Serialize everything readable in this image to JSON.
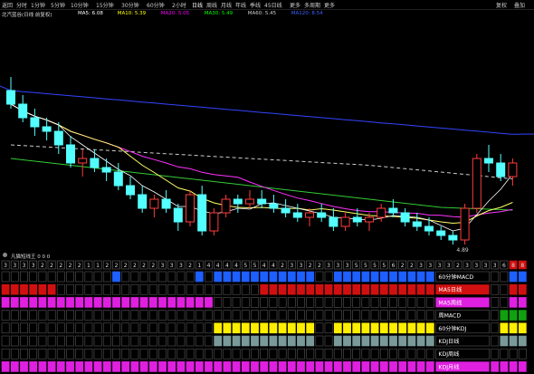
{
  "period_bar": {
    "items": [
      {
        "label": "返回"
      },
      {
        "label": "分时"
      },
      {
        "label": "1分钟"
      },
      {
        "label": "5分钟"
      },
      {
        "label": "10分钟"
      },
      {
        "label": "15分钟"
      },
      {
        "label": "30分钟"
      },
      {
        "label": "60分钟"
      },
      {
        "label": "2小时"
      },
      {
        "label": "日线",
        "active": true
      },
      {
        "label": "周线"
      },
      {
        "label": "月线"
      },
      {
        "label": "年线"
      },
      {
        "label": "季线"
      },
      {
        "label": "45日线"
      },
      {
        "label": "更多"
      },
      {
        "label": "多周期"
      },
      {
        "label": "更多"
      }
    ],
    "right_items": [
      {
        "label": "复权"
      },
      {
        "label": "叠加"
      }
    ]
  },
  "indicators": {
    "stock_name": "北汽蓝谷(日线 前复权)",
    "items": [
      {
        "label": "MA5: 6.08",
        "color": "#ffffff"
      },
      {
        "label": "MA10: 5.39",
        "color": "#ffff00"
      },
      {
        "label": "MA20: 5.05",
        "color": "#ff00ff"
      },
      {
        "label": "MA30: 5.49",
        "color": "#00ff00"
      },
      {
        "label": "MA60: 5.45",
        "color": "#cccccc"
      },
      {
        "label": "MA120: 8.54",
        "color": "#4060ff"
      }
    ]
  },
  "colors": {
    "up": "#ff3b3b",
    "down": "#54ffff",
    "ma5": "#ffffff",
    "ma10": "#ffff66",
    "ma20": "#ff33ff",
    "ma30": "#33cc33",
    "ma120": "#3344ff",
    "blue_cell": "#1e5fff",
    "red_cell": "#d01010",
    "magenta_cell": "#e020e0",
    "yellow_cell": "#ffee00",
    "gray_cell": "#7a9a9a",
    "green_cell": "#10a010"
  },
  "chart_data": {
    "type": "candlestick",
    "ylim": [
      4.0,
      11.0
    ],
    "annotation_low": "4.89",
    "bars": [
      {
        "o": 7.6,
        "h": 7.9,
        "l": 7.2,
        "c": 7.3
      },
      {
        "o": 7.3,
        "h": 7.5,
        "l": 6.9,
        "c": 7.0
      },
      {
        "o": 7.0,
        "h": 7.2,
        "l": 6.6,
        "c": 6.8
      },
      {
        "o": 6.8,
        "h": 7.0,
        "l": 6.5,
        "c": 6.7
      },
      {
        "o": 6.7,
        "h": 6.9,
        "l": 6.2,
        "c": 6.4
      },
      {
        "o": 6.4,
        "h": 6.6,
        "l": 5.9,
        "c": 6.0
      },
      {
        "o": 6.0,
        "h": 6.3,
        "l": 5.7,
        "c": 6.1
      },
      {
        "o": 6.1,
        "h": 6.3,
        "l": 5.8,
        "c": 5.9
      },
      {
        "o": 5.9,
        "h": 6.1,
        "l": 5.6,
        "c": 5.8
      },
      {
        "o": 5.8,
        "h": 6.0,
        "l": 5.4,
        "c": 5.5
      },
      {
        "o": 5.5,
        "h": 5.7,
        "l": 5.2,
        "c": 5.3
      },
      {
        "o": 5.3,
        "h": 5.5,
        "l": 4.9,
        "c": 5.0
      },
      {
        "o": 5.0,
        "h": 5.3,
        "l": 4.8,
        "c": 5.2
      },
      {
        "o": 5.2,
        "h": 5.4,
        "l": 4.9,
        "c": 5.0
      },
      {
        "o": 5.0,
        "h": 5.1,
        "l": 4.5,
        "c": 4.7
      },
      {
        "o": 4.7,
        "h": 5.4,
        "l": 4.6,
        "c": 5.3
      },
      {
        "o": 5.3,
        "h": 5.5,
        "l": 4.4,
        "c": 4.5
      },
      {
        "o": 4.5,
        "h": 5.0,
        "l": 4.4,
        "c": 4.9
      },
      {
        "o": 4.9,
        "h": 5.3,
        "l": 4.8,
        "c": 5.2
      },
      {
        "o": 5.2,
        "h": 5.3,
        "l": 4.9,
        "c": 5.1
      },
      {
        "o": 5.1,
        "h": 5.4,
        "l": 5.0,
        "c": 5.2
      },
      {
        "o": 5.2,
        "h": 5.4,
        "l": 5.0,
        "c": 5.1
      },
      {
        "o": 5.1,
        "h": 5.3,
        "l": 4.9,
        "c": 5.0
      },
      {
        "o": 5.0,
        "h": 5.2,
        "l": 4.8,
        "c": 4.9
      },
      {
        "o": 4.9,
        "h": 5.1,
        "l": 4.7,
        "c": 4.8
      },
      {
        "o": 4.8,
        "h": 5.0,
        "l": 4.6,
        "c": 4.9
      },
      {
        "o": 4.9,
        "h": 5.1,
        "l": 4.7,
        "c": 4.8
      },
      {
        "o": 4.8,
        "h": 5.0,
        "l": 4.5,
        "c": 4.6
      },
      {
        "o": 4.6,
        "h": 4.9,
        "l": 4.5,
        "c": 4.8
      },
      {
        "o": 4.8,
        "h": 5.0,
        "l": 4.6,
        "c": 4.7
      },
      {
        "o": 4.7,
        "h": 4.9,
        "l": 4.5,
        "c": 4.8
      },
      {
        "o": 4.8,
        "h": 5.1,
        "l": 4.7,
        "c": 5.0
      },
      {
        "o": 5.0,
        "h": 5.2,
        "l": 4.8,
        "c": 4.9
      },
      {
        "o": 4.9,
        "h": 5.0,
        "l": 4.6,
        "c": 4.7
      },
      {
        "o": 4.7,
        "h": 4.9,
        "l": 4.5,
        "c": 4.6
      },
      {
        "o": 4.6,
        "h": 4.8,
        "l": 4.4,
        "c": 4.5
      },
      {
        "o": 4.5,
        "h": 4.6,
        "l": 4.3,
        "c": 4.4
      },
      {
        "o": 4.4,
        "h": 4.5,
        "l": 4.2,
        "c": 4.3
      },
      {
        "o": 4.3,
        "h": 5.1,
        "l": 4.2,
        "c": 5.0
      },
      {
        "o": 5.0,
        "h": 6.2,
        "l": 4.9,
        "c": 6.1
      },
      {
        "o": 6.1,
        "h": 6.4,
        "l": 5.8,
        "c": 6.0
      },
      {
        "o": 6.0,
        "h": 6.2,
        "l": 5.6,
        "c": 5.7
      },
      {
        "o": 5.7,
        "h": 6.1,
        "l": 5.5,
        "c": 6.0
      }
    ]
  },
  "sub_panel": {
    "title": "凡猫短线王 0 0 0"
  },
  "signal_grid": {
    "count_row": [
      "3",
      "3",
      "3",
      "3",
      "2",
      "2",
      "2",
      "2",
      "2",
      "1",
      "1",
      "2",
      "2",
      "2",
      "2",
      "2",
      "2",
      "3",
      "3",
      "3",
      "2",
      "1",
      "4",
      "4",
      "4",
      "4",
      "5",
      "5",
      "4",
      "4",
      "2",
      "3",
      "3",
      "2",
      "2",
      "3",
      "3",
      "3",
      "5",
      "5",
      "5",
      "5",
      "6",
      "2",
      "2",
      "3",
      "3",
      "3",
      "3",
      "2",
      "3",
      "3",
      "3",
      "3",
      "6",
      "8",
      "8"
    ],
    "count_highlight": [
      55,
      56
    ],
    "rows": [
      {
        "label": "60分钟MACD",
        "label_color": "#ffffff",
        "label_bg": "",
        "cell": "blue_cell",
        "on": [
          12,
          21,
          23,
          24,
          25,
          26,
          27,
          28,
          29,
          30,
          31,
          32,
          33,
          36,
          37,
          38,
          39,
          40,
          41,
          42,
          43,
          44,
          45,
          46,
          49,
          55,
          56
        ]
      },
      {
        "label": "MA5日线",
        "label_color": "#ffffff",
        "label_bg": "#d01010",
        "cell": "red_cell",
        "on": [
          0,
          1,
          2,
          3,
          4,
          5,
          28,
          29,
          30,
          31,
          32,
          33,
          34,
          35,
          36,
          37,
          38,
          39,
          40,
          41,
          42,
          43,
          44,
          45,
          46,
          47,
          48,
          49,
          50,
          55,
          56
        ]
      },
      {
        "label": "MA5周线",
        "label_color": "#ffffff",
        "label_bg": "#e020e0",
        "cell": "magenta_cell",
        "on": [
          0,
          1,
          2,
          3,
          4,
          5,
          6,
          7,
          8,
          9,
          10,
          11,
          12,
          13,
          14,
          15,
          16,
          17,
          18,
          19,
          20,
          21,
          22,
          55,
          56
        ]
      },
      {
        "label": "周MACD",
        "label_color": "#ffffff",
        "label_bg": "",
        "cell": "green_cell",
        "on": [
          54,
          55,
          56
        ]
      },
      {
        "label": "60分钟KDJ",
        "label_color": "#ffffff",
        "label_bg": "",
        "cell": "yellow_cell",
        "on": [
          23,
          24,
          25,
          26,
          27,
          28,
          29,
          30,
          31,
          32,
          33,
          36,
          37,
          38,
          39,
          40,
          41,
          42,
          43,
          44,
          45,
          46,
          54,
          55,
          56
        ]
      },
      {
        "label": "KDJ日线",
        "label_color": "#ffffff",
        "label_bg": "",
        "cell": "gray_cell",
        "on": [
          23,
          24,
          25,
          26,
          27,
          28,
          29,
          30,
          31,
          32,
          33,
          36,
          37,
          38,
          39,
          40,
          41,
          42,
          43,
          44,
          45,
          46,
          54,
          55,
          56
        ]
      },
      {
        "label": "KDJ周线",
        "label_color": "#ffffff",
        "label_bg": "",
        "cell": "gray_cell",
        "on": []
      },
      {
        "label": "KDJ月线",
        "label_color": "#ffffff",
        "label_bg": "#e020e0",
        "cell": "magenta_cell",
        "on": [
          0,
          1,
          2,
          3,
          4,
          5,
          6,
          7,
          8,
          9,
          10,
          11,
          12,
          13,
          14,
          15,
          16,
          17,
          18,
          19,
          20,
          21,
          22,
          23,
          24,
          25,
          26,
          27,
          28,
          29,
          30,
          31,
          32,
          33,
          34,
          35,
          36,
          37,
          38,
          39,
          40,
          41,
          42,
          43,
          44,
          45,
          46,
          47,
          48,
          49,
          50,
          51,
          52,
          53,
          54,
          55,
          56
        ]
      }
    ]
  }
}
